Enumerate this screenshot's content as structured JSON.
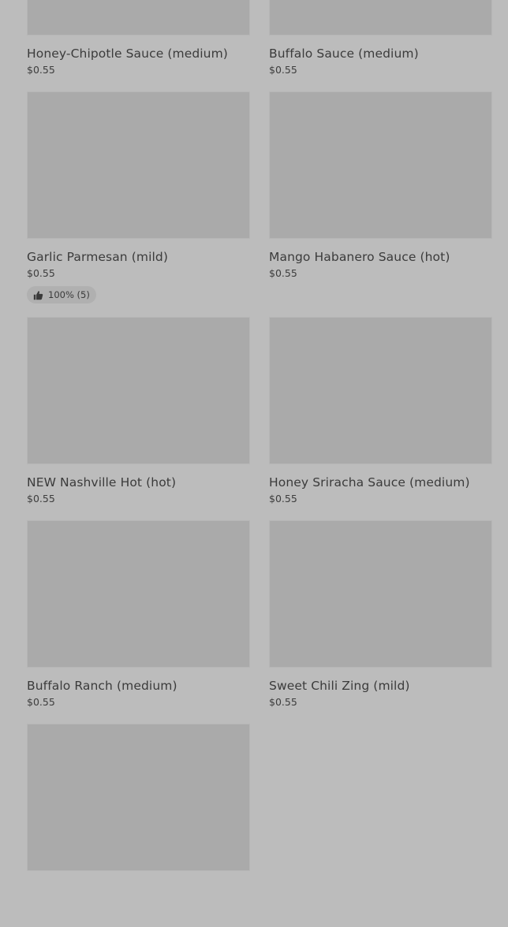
{
  "items": [
    {
      "name": "Honey-Chipotle Sauce (medium)",
      "price": "$0.55"
    },
    {
      "name": "Buffalo Sauce (medium)",
      "price": "$0.55"
    },
    {
      "name": "Garlic Parmesan (mild)",
      "price": "$0.55",
      "rating": "100% (5)"
    },
    {
      "name": "Mango Habanero Sauce (hot)",
      "price": "$0.55"
    },
    {
      "name": "NEW Nashville Hot (hot)",
      "price": "$0.55"
    },
    {
      "name": "Honey Sriracha Sauce (medium)",
      "price": "$0.55"
    },
    {
      "name": "Buffalo Ranch (medium)",
      "price": "$0.55"
    },
    {
      "name": "Sweet Chili Zing (mild)",
      "price": "$0.55"
    },
    {
      "name": "",
      "price": ""
    }
  ],
  "icons": {
    "rating": "thumbs-up-icon"
  },
  "colors": {
    "background": "#bcbcbc",
    "image_placeholder": "#aaaaaa",
    "text": "#3b3b3b"
  }
}
